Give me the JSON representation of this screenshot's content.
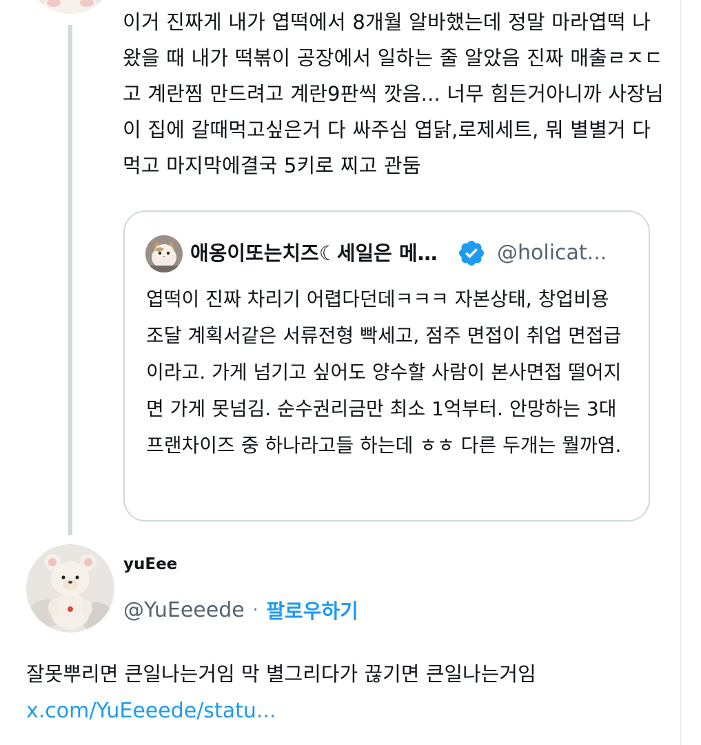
{
  "colors": {
    "text": "#0f1419",
    "secondary": "#536471",
    "accent": "#1d9bf0",
    "border": "#cfd9de",
    "thread_line": "#cfd9de"
  },
  "tweet1": {
    "text": "이거 진짜게 내가 엽떡에서 8개월 알바했는데 정말 마라엽떡 나왔을 때 내가 떡볶이 공장에서 일하는 줄 알았음 진짜 매출ㄹㅈㄷ고 계란찜 만드려고 계란9판씩 깟음... 너무 힘든거아니까 사장님이 집에 갈때먹고싶은거 다 싸주심 엽닭,로제세트, 뭐 별별거 다 먹고 마지막에결국 5키로 찌고 관둠"
  },
  "quote": {
    "avatar_icon": "cat-avatar-icon",
    "name": "애옹이또는치즈☾세일은 메인...",
    "verified_icon": "verified-badge-icon",
    "handle": "@holicat...",
    "text": "엽떡이 진짜 차리기 어렵다던데ㅋㅋㅋ 자본상태, 창업비용 조달 계획서같은 서류전형 빡세고, 점주 면접이 취업 면접급이라고. 가게 넘기고 싶어도 양수할 사람이 본사면접 떨어지면 가게 못넘김. 순수권리금만 최소 1억부터. 안망하는 3대 프랜차이즈 중 하나라고들 하는데 ㅎㅎ 다른 두개는 뭘까염."
  },
  "author": {
    "avatar_icon": "teddy-bear-avatar-icon",
    "name": "yuEee",
    "handle": "@YuEeeede",
    "separator": "·",
    "follow_label": "팔로우하기"
  },
  "tweet2": {
    "text": "잘못뿌리면 큰일나는거임 막 별그리다가 끊기면 큰일나는거임",
    "link": "x.com/YuEeeede/statu..."
  }
}
